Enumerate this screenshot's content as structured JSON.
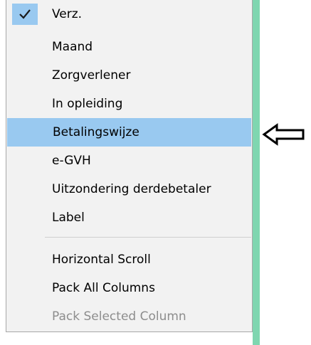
{
  "menu": {
    "items": [
      {
        "label": "Verz.",
        "checked": true,
        "state": "normal"
      },
      {
        "label": "Maand",
        "checked": false,
        "state": "normal"
      },
      {
        "label": "Zorgverlener",
        "checked": false,
        "state": "normal"
      },
      {
        "label": "In opleiding",
        "checked": false,
        "state": "normal"
      },
      {
        "label": "Betalingswijze",
        "checked": false,
        "state": "highlighted"
      },
      {
        "label": "e-GVH",
        "checked": false,
        "state": "normal"
      },
      {
        "label": "Uitzondering derdebetaler",
        "checked": false,
        "state": "normal"
      },
      {
        "label": "Label",
        "checked": false,
        "state": "normal"
      }
    ],
    "actions": [
      {
        "label": "Horizontal Scroll",
        "state": "normal"
      },
      {
        "label": "Pack All Columns",
        "state": "normal"
      },
      {
        "label": "Pack Selected Column",
        "state": "disabled"
      }
    ]
  },
  "icons": {
    "check": "checkmark-icon",
    "pointer": "left-arrow-icon"
  },
  "colors": {
    "menu_background": "#f2f2f2",
    "highlight": "#99c9f0",
    "side_strip": "#7fd6b0",
    "disabled_text": "#8d8d8d"
  }
}
